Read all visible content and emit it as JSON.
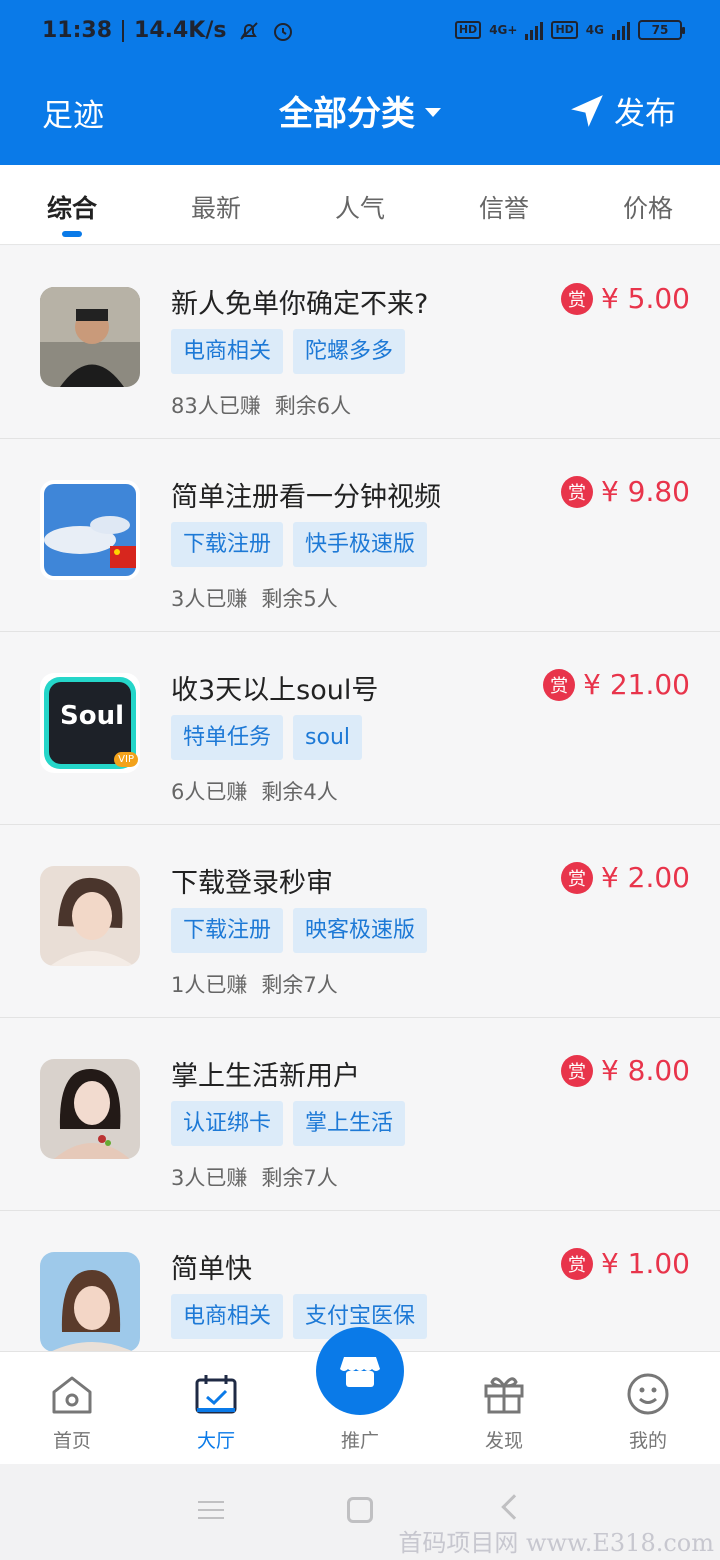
{
  "status": {
    "time": "11:38",
    "speed": "14.4K/s",
    "battery": "75",
    "network1": "4G+",
    "network2": "4G",
    "hd": "HD"
  },
  "header": {
    "left": "足迹",
    "title": "全部分类",
    "publish": "发布"
  },
  "tabs": [
    {
      "label": "综合"
    },
    {
      "label": "最新"
    },
    {
      "label": "人气"
    },
    {
      "label": "信誉"
    },
    {
      "label": "价格"
    }
  ],
  "tasks": [
    {
      "title": "新人免单你确定不来?",
      "reward_badge": "赏",
      "price": "¥ 5.00",
      "tags": [
        "电商相关",
        "陀螺多多"
      ],
      "earned": "83人已赚",
      "remaining": "剩余6人"
    },
    {
      "title": "简单注册看一分钟视频",
      "reward_badge": "赏",
      "price": "¥ 9.80",
      "tags": [
        "下载注册",
        "快手极速版"
      ],
      "earned": "3人已赚",
      "remaining": "剩余5人"
    },
    {
      "title": "收3天以上soul号",
      "reward_badge": "赏",
      "price": "¥ 21.00",
      "tags": [
        "特单任务",
        "soul"
      ],
      "earned": "6人已赚",
      "remaining": "剩余4人",
      "avatar_text": "Soul",
      "avatar_badge": "VIP"
    },
    {
      "title": "下载登录秒审",
      "reward_badge": "赏",
      "price": "¥ 2.00",
      "tags": [
        "下载注册",
        "映客极速版"
      ],
      "earned": "1人已赚",
      "remaining": "剩余7人"
    },
    {
      "title": "掌上生活新用户",
      "reward_badge": "赏",
      "price": "¥ 8.00",
      "tags": [
        "认证绑卡",
        "掌上生活"
      ],
      "earned": "3人已赚",
      "remaining": "剩余7人"
    },
    {
      "title": "简单快",
      "reward_badge": "赏",
      "price": "¥ 1.00",
      "tags": [
        "电商相关",
        "支付宝医保"
      ],
      "earned": "",
      "remaining": ""
    }
  ],
  "nav": [
    {
      "label": "首页",
      "icon": "home-icon"
    },
    {
      "label": "大厅",
      "icon": "calendar-check-icon",
      "active": true
    },
    {
      "label": "推广",
      "icon": "shop-icon"
    },
    {
      "label": "发现",
      "icon": "gift-icon"
    },
    {
      "label": "我的",
      "icon": "smile-icon"
    }
  ],
  "watermark": "首码项目网 www.E318.com",
  "colors": {
    "primary": "#0a7ae8",
    "price": "#e8344b",
    "tag_bg": "#dcebf9",
    "tag_text": "#1d79d6"
  }
}
